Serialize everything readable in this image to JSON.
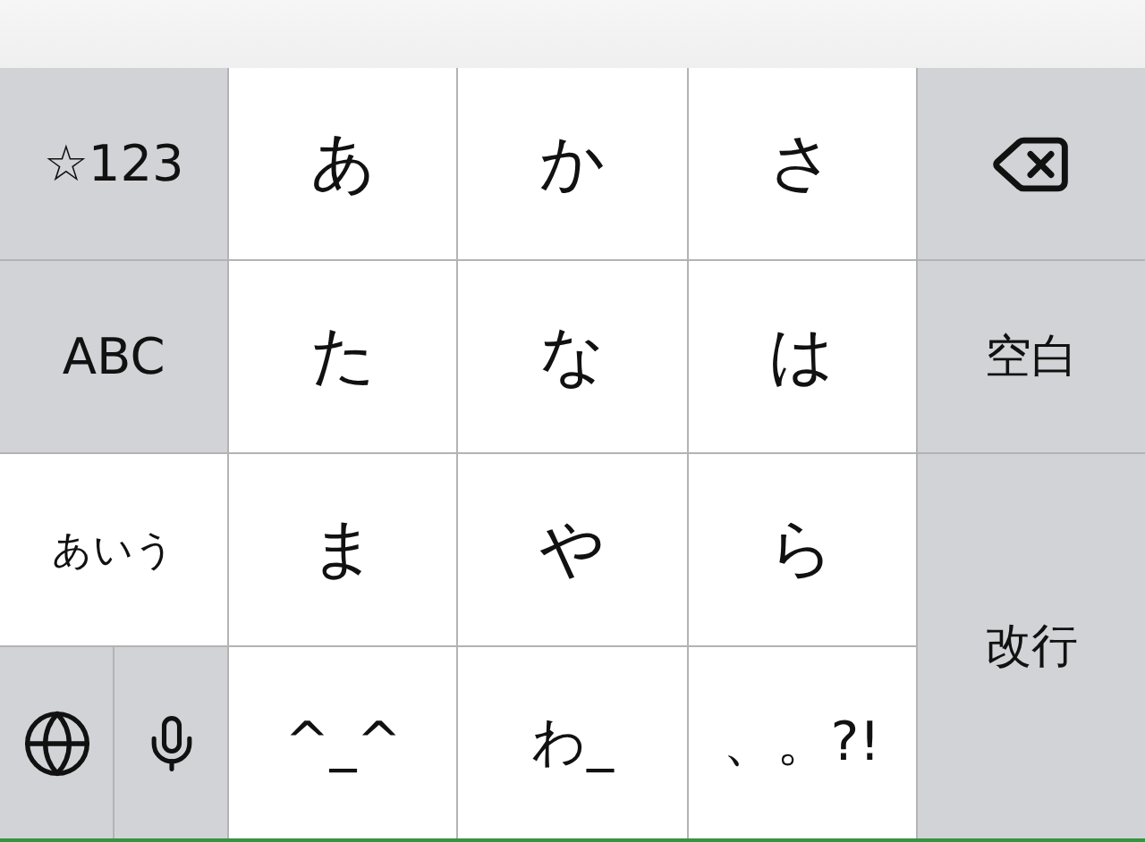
{
  "mode_keys": [
    {
      "label": "☆123",
      "selected": false
    },
    {
      "label": "ABC",
      "selected": false
    },
    {
      "label": "あいう",
      "selected": true
    }
  ],
  "kana_keys": [
    "あ",
    "か",
    "さ",
    "た",
    "な",
    "は",
    "ま",
    "や",
    "ら",
    "^_^",
    "わ_",
    "、。?!"
  ],
  "space_key": "空白",
  "return_key": "改行"
}
